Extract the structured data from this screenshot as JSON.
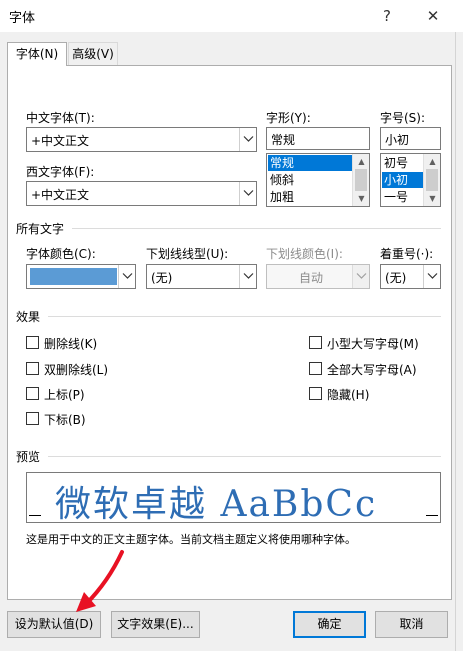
{
  "window": {
    "title": "字体",
    "help_button": "?",
    "close_button": "✕"
  },
  "tabs": [
    {
      "label": "字体(N)",
      "active": true
    },
    {
      "label": "高级(V)",
      "active": false
    }
  ],
  "font": {
    "chinese_font_label": "中文字体(T):",
    "chinese_font_value": "+中文正文",
    "western_font_label": "西文字体(F):",
    "western_font_value": "+中文正文",
    "style_label": "字形(Y):",
    "style_value": "常规",
    "style_options": [
      "常规",
      "倾斜",
      "加粗"
    ],
    "style_selected": "常规",
    "size_label": "字号(S):",
    "size_value": "小初",
    "size_options": [
      "初号",
      "小初",
      "一号"
    ],
    "size_selected": "小初"
  },
  "all_text": {
    "section_label": "所有文字",
    "font_color_label": "字体颜色(C):",
    "font_color_swatch": "#5b9bd5",
    "underline_style_label": "下划线线型(U):",
    "underline_style_value": "(无)",
    "underline_color_label": "下划线颜色(I):",
    "underline_color_value": "自动",
    "emphasis_label": "着重号(·):",
    "emphasis_value": "(无)"
  },
  "effects": {
    "section_label": "效果",
    "left": [
      "删除线(K)",
      "双删除线(L)",
      "上标(P)",
      "下标(B)"
    ],
    "right": [
      "小型大写字母(M)",
      "全部大写字母(A)",
      "隐藏(H)"
    ]
  },
  "preview": {
    "section_label": "预览",
    "sample_text": "微软卓越  AaBbCc",
    "sample_color": "#2e6db4",
    "note": "这是用于中文的正文主题字体。当前文档主题定义将使用哪种字体。"
  },
  "buttons": {
    "set_default": "设为默认值(D)",
    "text_effects": "文字效果(E)...",
    "ok": "确定",
    "cancel": "取消"
  },
  "colors": {
    "accent": "#0078d7",
    "arrow": "#e81123"
  }
}
